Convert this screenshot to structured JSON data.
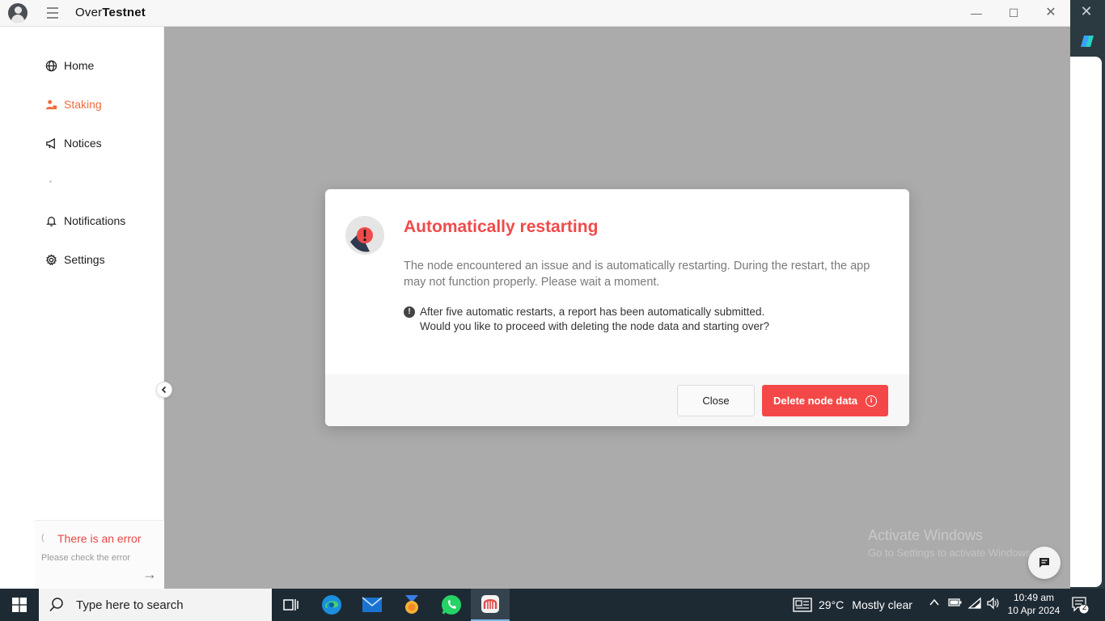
{
  "app": {
    "title_prefix": "Over",
    "title_bold": "Testnet"
  },
  "sidebar": {
    "items": [
      {
        "label": "Home",
        "icon": "globe-icon"
      },
      {
        "label": "Staking",
        "icon": "staking-icon",
        "active": true
      },
      {
        "label": "Notices",
        "icon": "megaphone-icon"
      },
      {
        "label": "Notifications",
        "icon": "bell-icon"
      },
      {
        "label": "Settings",
        "icon": "gear-icon"
      }
    ],
    "error": {
      "title": "There is an error",
      "subtitle": "Please check the error"
    }
  },
  "modal": {
    "title": "Automatically restarting",
    "description": "The node encountered an issue and is automatically restarting. During the restart, the app may not function properly. Please wait a moment.",
    "note_line1": "After five automatic restarts, a report has been automatically submitted.",
    "note_line2": "Would you like to proceed with deleting the node data and starting over?",
    "close_label": "Close",
    "delete_label": "Delete node data"
  },
  "watermark": {
    "line1": "Activate Windows",
    "line2": "Go to Settings to activate Windows."
  },
  "taskbar": {
    "search_placeholder": "Type here to search",
    "weather_temp": "29°C",
    "weather_desc": "Mostly clear",
    "time": "10:49 am",
    "date": "10 Apr 2024",
    "notification_count": "2"
  },
  "colors": {
    "accent_orange": "#ef6c3b",
    "error_red": "#ef4b4b",
    "delete_button": "#f44848"
  }
}
